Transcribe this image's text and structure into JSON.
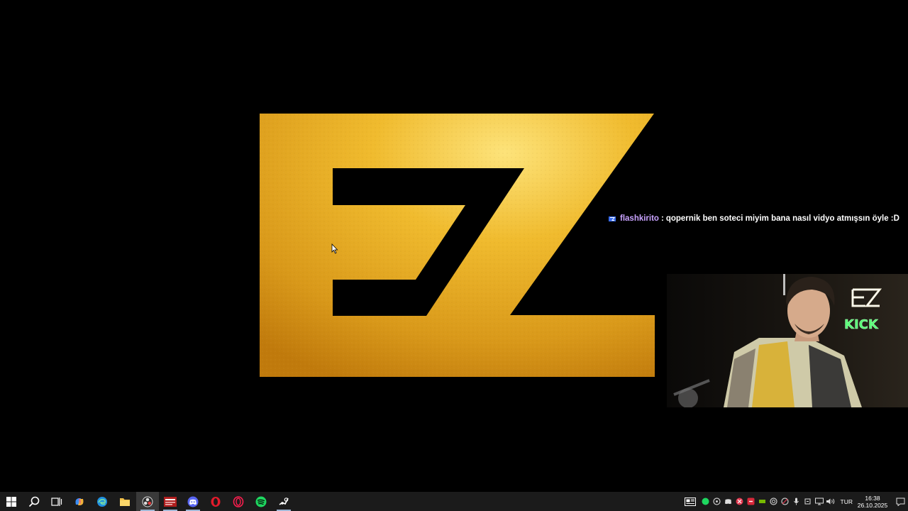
{
  "chat": {
    "username": "flashkirito",
    "separator": ":",
    "message": "qopernik ben soteci miyim bana nasıl vidyo atmışsın öyle :D"
  },
  "overlay": {
    "logo_letters": "EZ",
    "kick_label": "KICK"
  },
  "taskbar": {
    "apps": [
      {
        "name": "windows-start",
        "icon": "windows-logo-icon"
      },
      {
        "name": "search",
        "icon": "search-icon"
      },
      {
        "name": "task-view",
        "icon": "task-view-icon"
      },
      {
        "name": "copilot",
        "icon": "copilot-icon"
      },
      {
        "name": "edge",
        "icon": "edge-icon"
      },
      {
        "name": "file-explorer",
        "icon": "folder-icon"
      },
      {
        "name": "obs",
        "icon": "obs-icon"
      },
      {
        "name": "voicemeeter",
        "icon": "voicemeeter-icon"
      },
      {
        "name": "discord",
        "icon": "discord-icon"
      },
      {
        "name": "opera",
        "icon": "opera-icon"
      },
      {
        "name": "opera-gx",
        "icon": "opera-gx-icon"
      },
      {
        "name": "spotify",
        "icon": "spotify-icon"
      },
      {
        "name": "steam",
        "icon": "steam-icon"
      }
    ],
    "language": "TUR",
    "time": "16:38",
    "date": "26.10.2025"
  },
  "colors": {
    "gold_light": "#f3c23a",
    "gold_dark": "#c98a10",
    "username": "#c9a3ff",
    "taskbar_bg": "#1b1b1b"
  }
}
